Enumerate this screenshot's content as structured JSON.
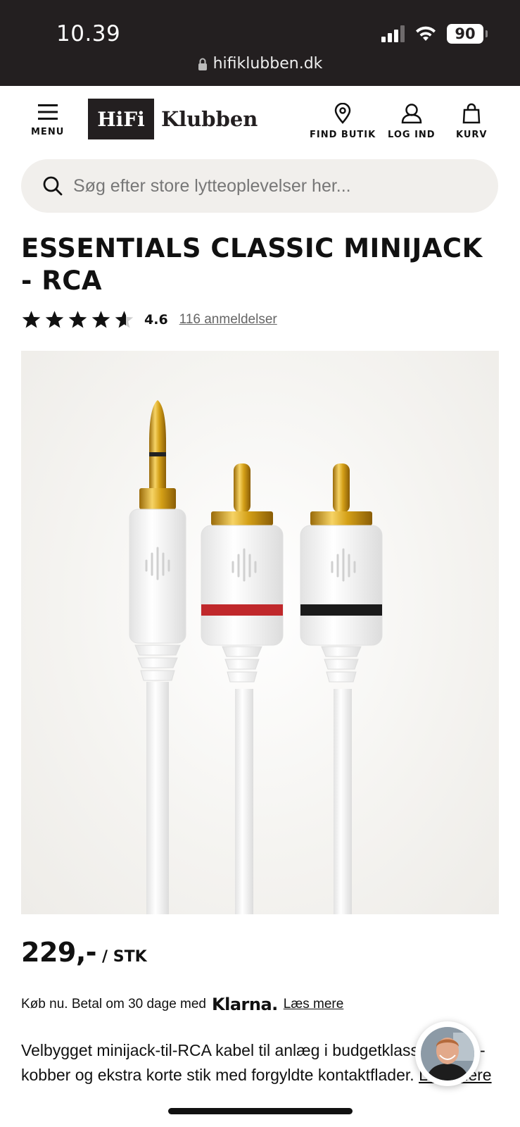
{
  "status_bar": {
    "time": "10.39",
    "battery": "90",
    "url": "hifiklubben.dk"
  },
  "header": {
    "menu_label": "MENU",
    "logo_box": "HiFi",
    "logo_text": "Klubben",
    "find_store_label": "FIND BUTIK",
    "login_label": "LOG IND",
    "cart_label": "KURV"
  },
  "search": {
    "placeholder": "Søg efter store lytteoplevelser her..."
  },
  "product": {
    "title": "ESSENTIALS CLASSIC MINIJACK - RCA",
    "rating": 4.6,
    "rating_text": "4.6",
    "reviews_link": "116 anmeldelser",
    "price": "229,-",
    "price_unit": "/ STK",
    "klarna_prefix": "Køb nu. Betal om 30 dage med",
    "klarna_logo": "Klarna.",
    "klarna_link": "Læs mere",
    "description": "Velbygget minijack-til-RCA kabel til anlæg i budgetklassen. OFC-kobber og ekstra korte stik med forgyldte kontaktflader.",
    "read_more": "Læs mere"
  },
  "colors": {
    "brand_dark": "#231f20",
    "search_bg": "#f1efec",
    "gold": "#d4a017",
    "red_ring": "#c0282b",
    "black_ring": "#1a1a1a"
  }
}
